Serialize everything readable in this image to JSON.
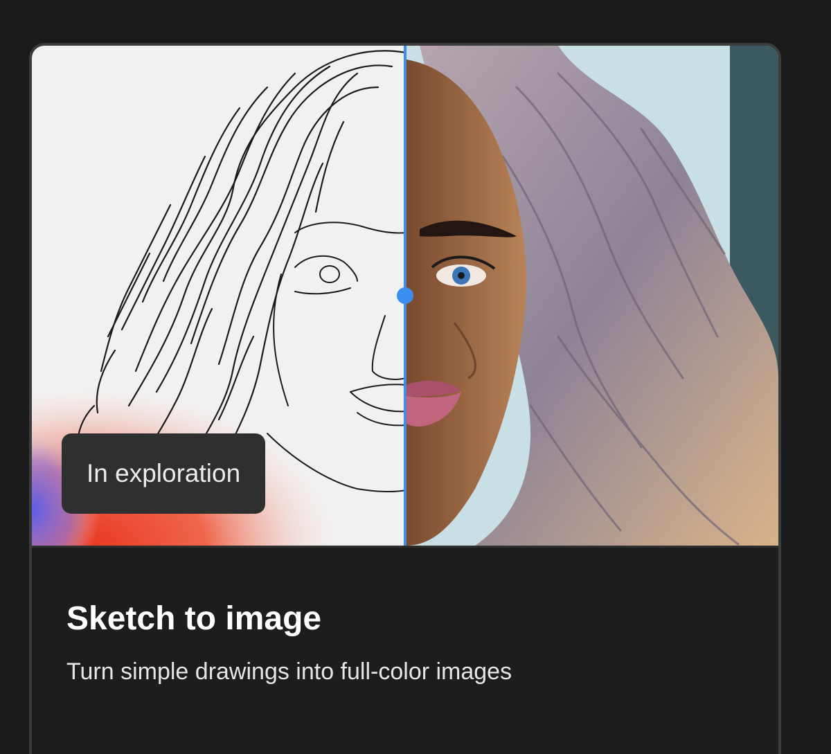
{
  "card": {
    "badge": "In exploration",
    "title": "Sketch to image",
    "subtitle": "Turn simple drawings into full-color images"
  },
  "compare": {
    "left_panel": "sketch-drawing",
    "right_panel": "full-color-image",
    "position_percent": 50
  },
  "colors": {
    "background": "#1b1b1b",
    "card_border": "#3c3c3c",
    "accent": "#3b8ef0",
    "badge_bg": "#2f2f2f",
    "sketch_bg": "#f1f1f1",
    "sky": "#c9dfe6",
    "hair": "#a79aa8",
    "skin": "#9b6a48"
  }
}
